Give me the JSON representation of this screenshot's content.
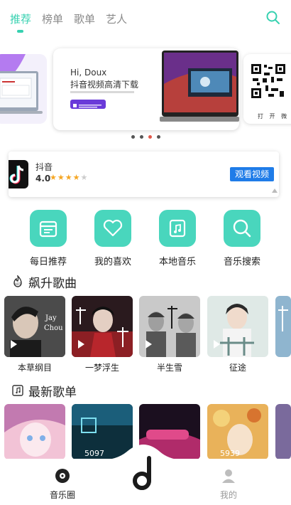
{
  "tabs": [
    "推荐",
    "榜单",
    "歌单",
    "艺人"
  ],
  "banner": {
    "greeting": "Hi, Doux",
    "title": "抖音视频高清下载",
    "caption": "打 开 微"
  },
  "ad": {
    "app_name": "抖音",
    "rating": "4.0",
    "stars": [
      "★",
      "★",
      "★",
      "★",
      "★"
    ],
    "button": "观看视频"
  },
  "quick_actions": [
    {
      "label": "每日推荐",
      "icon": "calendar-icon"
    },
    {
      "label": "我的喜欢",
      "icon": "heart-icon"
    },
    {
      "label": "本地音乐",
      "icon": "music-file-icon"
    },
    {
      "label": "音乐搜索",
      "icon": "search-icon"
    }
  ],
  "sections": {
    "hot": "飙升歌曲",
    "playlists": "最新歌单"
  },
  "songs": [
    "本草纲目",
    "一梦浮生",
    "半生雪",
    "征途"
  ],
  "playlists": {
    "counts": [
      "5097",
      "5939"
    ]
  },
  "bottom_nav": {
    "left": "音乐圈",
    "right": "我的"
  },
  "colors": {
    "accent": "#36d1b0",
    "ad_button": "#1f7ce8"
  }
}
